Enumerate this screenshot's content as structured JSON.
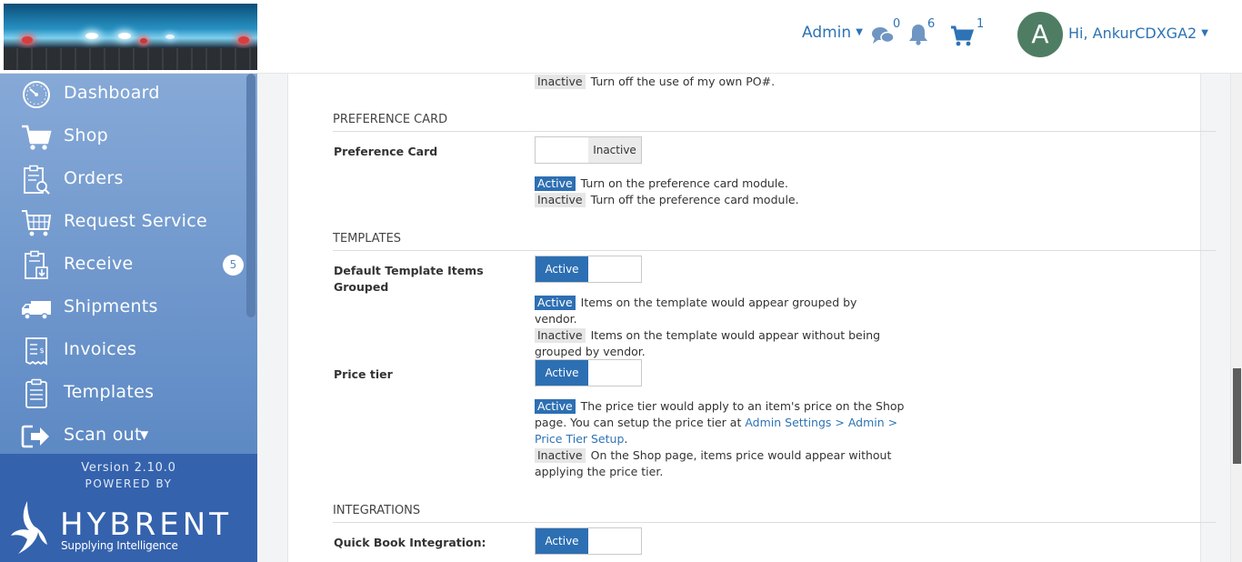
{
  "header": {
    "admin_label": "Admin",
    "messages_count": "0",
    "notifications_count": "6",
    "cart_count": "1",
    "avatar_initial": "A",
    "user_greeting": "Hi, AnkurCDXGA2"
  },
  "sidebar": {
    "items": [
      {
        "label": "Dashboard",
        "icon": "dashboard-gauge-icon"
      },
      {
        "label": "Shop",
        "icon": "shopping-cart-icon"
      },
      {
        "label": "Orders",
        "icon": "orders-clipboard-search-icon"
      },
      {
        "label": "Request Service",
        "icon": "request-service-cart-icon"
      },
      {
        "label": "Receive",
        "icon": "receive-clipboard-icon",
        "badge": "5"
      },
      {
        "label": "Shipments",
        "icon": "delivery-truck-icon"
      },
      {
        "label": "Invoices",
        "icon": "invoice-receipt-icon"
      },
      {
        "label": "Templates",
        "icon": "templates-clipboard-icon"
      },
      {
        "label": "Scan out",
        "icon": "scan-out-exit-icon"
      }
    ],
    "version": "Version 2.10.0",
    "powered_by": "POWERED BY",
    "brand_name": "HYBRENT",
    "brand_tagline": "Supplying Intelligence"
  },
  "colors": {
    "accent": "#2d6fb3",
    "sidebar_bg": "#6f98cf",
    "sidebar_footer": "#3462ad",
    "link": "#2d73b5",
    "avatar_bg": "#4f7d64"
  },
  "content": {
    "po_inactive_tag": "Inactive",
    "po_inactive_desc": "Turn off the use of my own PO#.",
    "preference_section": "PREFERENCE CARD",
    "preference_card": {
      "label": "Preference Card",
      "toggle_text": "Inactive",
      "active_tag": "Active",
      "active_desc": "Turn on the preference card module.",
      "inactive_tag": "Inactive",
      "inactive_desc": "Turn off the preference card module."
    },
    "templates_section": "TEMPLATES",
    "default_template": {
      "label": "Default Template Items Grouped",
      "toggle_text": "Active",
      "active_tag": "Active",
      "active_desc": "Items on the template would appear grouped by vendor.",
      "inactive_tag": "Inactive",
      "inactive_desc": "Items on the template would appear without being grouped by vendor."
    },
    "price_tier": {
      "label": "Price tier",
      "toggle_text": "Active",
      "active_tag": "Active",
      "active_desc_1": "The price tier would apply to an item's price on the Shop page. You can setup the price tier at ",
      "link_text": "Admin Settings > Admin > Price Tier Setup",
      "active_desc_2": ".",
      "inactive_tag": "Inactive",
      "inactive_desc": "On the Shop page, items price would appear without applying the price tier."
    },
    "integrations_section": "INTEGRATIONS",
    "quickbook": {
      "label": "Quick Book Integration:",
      "toggle_text": "Active"
    }
  }
}
